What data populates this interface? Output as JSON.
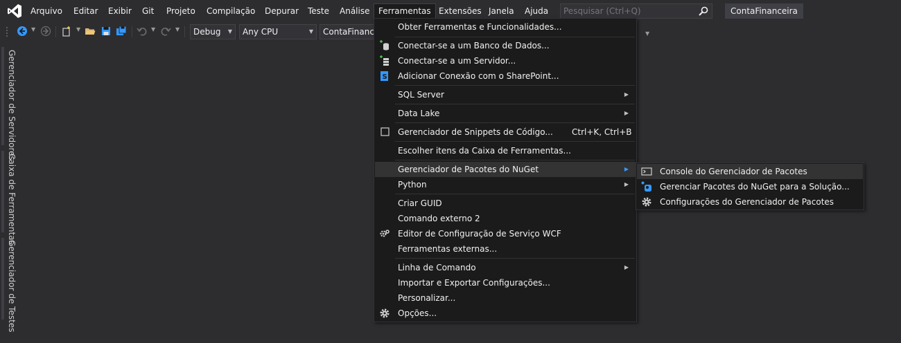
{
  "menubar": {
    "items": [
      "Arquivo",
      "Editar",
      "Exibir",
      "Git",
      "Projeto",
      "Compilação",
      "Depurar",
      "Teste",
      "Análise",
      "Ferramentas",
      "Extensões",
      "Janela",
      "Ajuda"
    ],
    "active_item": "Ferramentas",
    "search_placeholder": "Pesquisar (Ctrl+Q)",
    "solution_name": "ContaFinanceira"
  },
  "toolbar": {
    "configuration": "Debug",
    "platform": "Any CPU",
    "startup_project": "ContaFinance"
  },
  "side_tabs": [
    "Gerenciador de Servidores",
    "Caixa de Ferramentas",
    "Gerenciador de Testes"
  ],
  "tools_menu": {
    "items": [
      {
        "label": "Obter Ferramentas e Funcionalidades...",
        "icon": "",
        "shortcut": "",
        "submenu": false
      },
      {
        "label": "Conectar-se a um Banco de Dados...",
        "icon": "database-connect-icon",
        "shortcut": "",
        "submenu": false
      },
      {
        "label": "Conectar-se a um Servidor...",
        "icon": "server-connect-icon",
        "shortcut": "",
        "submenu": false
      },
      {
        "label": "Adicionar Conexão com o SharePoint...",
        "icon": "sharepoint-icon",
        "shortcut": "",
        "submenu": false
      },
      {
        "label": "SQL Server",
        "icon": "",
        "shortcut": "",
        "submenu": true
      },
      {
        "label": "Data Lake",
        "icon": "",
        "shortcut": "",
        "submenu": true
      },
      {
        "label": "Gerenciador de Snippets de Código...",
        "icon": "snippet-checkbox-icon",
        "shortcut": "Ctrl+K, Ctrl+B",
        "submenu": false
      },
      {
        "label": "Escolher itens da Caixa de Ferramentas...",
        "icon": "",
        "shortcut": "",
        "submenu": false
      },
      {
        "label": "Gerenciador de Pacotes do NuGet",
        "icon": "",
        "shortcut": "",
        "submenu": true
      },
      {
        "label": "Python",
        "icon": "",
        "shortcut": "",
        "submenu": true
      },
      {
        "label": "Criar GUID",
        "icon": "",
        "shortcut": "",
        "submenu": false
      },
      {
        "label": "Comando externo 2",
        "icon": "",
        "shortcut": "",
        "submenu": false
      },
      {
        "label": "Editor de Configuração de Serviço WCF",
        "icon": "wcf-gear-icon",
        "shortcut": "",
        "submenu": false
      },
      {
        "label": "Ferramentas externas...",
        "icon": "",
        "shortcut": "",
        "submenu": false
      },
      {
        "label": "Linha de Comando",
        "icon": "",
        "shortcut": "",
        "submenu": true
      },
      {
        "label": "Importar e Exportar Configurações...",
        "icon": "",
        "shortcut": "",
        "submenu": false
      },
      {
        "label": "Personalizar...",
        "icon": "",
        "shortcut": "",
        "submenu": false
      },
      {
        "label": "Opções...",
        "icon": "gear-icon",
        "shortcut": "",
        "submenu": false
      }
    ],
    "highlighted": "Gerenciador de Pacotes do NuGet"
  },
  "nuget_submenu": {
    "items": [
      {
        "label": "Console do Gerenciador de Pacotes",
        "icon": "console-icon"
      },
      {
        "label": "Gerenciar Pacotes do NuGet para a Solução...",
        "icon": "nuget-icon"
      },
      {
        "label": "Configurações do Gerenciador de Pacotes",
        "icon": "gear-icon"
      }
    ],
    "highlighted": "Console do Gerenciador de Pacotes"
  },
  "colors": {
    "background": "#2d2d30",
    "menu_background": "#1b1b1c",
    "highlight": "#333334",
    "text": "#f1f1f1",
    "accent": "#3399ff"
  }
}
